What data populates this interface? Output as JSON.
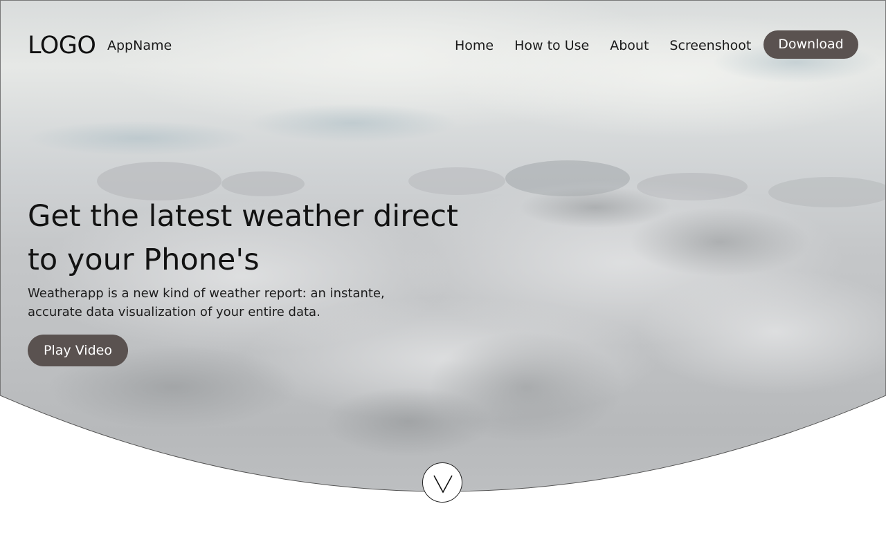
{
  "header": {
    "logo": "LOGO",
    "app_name": "AppName",
    "nav": [
      {
        "label": "Home"
      },
      {
        "label": "How to Use"
      },
      {
        "label": "About"
      },
      {
        "label": "Screenshoot"
      }
    ],
    "download_label": "Download"
  },
  "hero": {
    "title": "Get the latest weather direct to your Phone's",
    "subtitle": "Weatherapp is a new kind of weather report: an instante, accurate data visualization of your entire data.",
    "play_label": "Play Video",
    "background": "cloud-sky-photo",
    "scroll_icon": "chevron-down-icon"
  },
  "colors": {
    "button_bg": "#5a5250",
    "button_text": "#ffffff",
    "sky_top": "#dfe2e3",
    "cloud_mid": "#c4c6c8",
    "cloud_shadow": "#a9abad"
  }
}
